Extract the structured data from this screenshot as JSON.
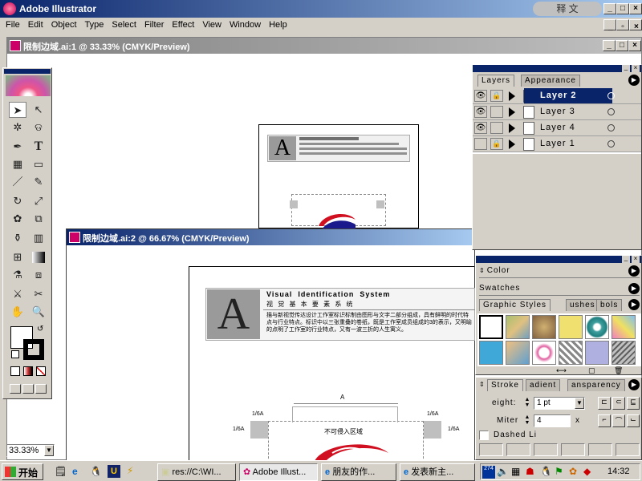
{
  "app": {
    "title": "Adobe Illustrator"
  },
  "menu": [
    "File",
    "Edit",
    "Object",
    "Type",
    "Select",
    "Filter",
    "Effect",
    "View",
    "Window",
    "Help"
  ],
  "doc1": {
    "title": "限制边域.ai:1 @ 33.33% (CMYK/Preview)"
  },
  "doc2": {
    "title": "限制边域.ai:2 @ 66.67% (CMYK/Preview)",
    "big_letter": "A",
    "heading_en": "Visual  Identification  System",
    "heading_cn": "视 觉 基 本 要 素 系 统",
    "body_text": "描与新视觉传达设计工作室标识标制由图形与文字二部分组成，具有鲜明的时代特点与行业特点。标识中以三张重叠的卷纸，既是工作室成员组成的3的表示，又明喻的点明了工作室的行业特点，又有一波三折的人生寓义。",
    "dim_label_top": "A",
    "dim_tl": "1/6A",
    "dim_tr": "1/6A",
    "dim_ml": "1/6A",
    "dim_mr": "1/6A",
    "zone_label": "不可侵入区域"
  },
  "doc1_letter": "A",
  "layers": {
    "tabs": [
      "Layers",
      "Appearance"
    ],
    "rows": [
      {
        "name": "Layer 2",
        "visible": true,
        "locked": true,
        "selected": true
      },
      {
        "name": "Layer 3",
        "visible": true,
        "locked": false,
        "selected": false
      },
      {
        "name": "Layer 4",
        "visible": true,
        "locked": false,
        "selected": false
      },
      {
        "name": "Layer 1",
        "visible": false,
        "locked": true,
        "selected": false
      }
    ]
  },
  "panels": {
    "color": "Color",
    "swatches": "Swatches",
    "graphic_styles_tabs": [
      "Graphic Styles",
      "ushes",
      "bols"
    ],
    "stroke_tabs": [
      "Stroke",
      "adient",
      "ansparency"
    ],
    "weight_label": "eight:",
    "weight_value": "1 pt",
    "miter_label": "Miter",
    "miter_value": "4",
    "miter_unit": "x",
    "dashed_label": "Dashed Li"
  },
  "zoom": "33.33%",
  "ime": "释 文",
  "taskbar": {
    "start": "开始",
    "tasks": [
      "res://C:\\WI...",
      "Adobe Illust...",
      "朋友的作...",
      "发表新主..."
    ],
    "clock": "14:32",
    "tray_num": "274"
  },
  "colors": {
    "titlebar": "#0a246a",
    "selected_layer": "#0a246a",
    "logo_red": "#d01020",
    "logo_blue": "#1a1a8c"
  }
}
